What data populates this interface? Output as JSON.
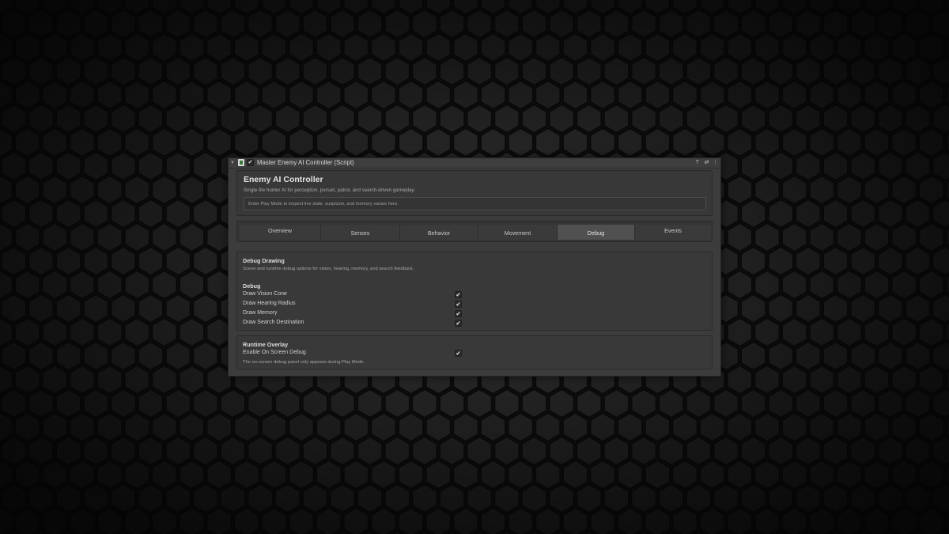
{
  "component": {
    "title": "Master Enemy AI Controller (Script)",
    "enabled": true,
    "icons": [
      "help-icon",
      "preset-icon",
      "more-icon"
    ]
  },
  "hero": {
    "title": "Enemy AI Controller",
    "subtitle": "Single-file hunter AI for perception, pursuit, patrol, and search-driven gameplay.",
    "status": "Enter Play Mode to inspect live state, suspicion, and memory values here."
  },
  "tabs": [
    {
      "label": "Overview",
      "active": false
    },
    {
      "label": "Senses",
      "active": false
    },
    {
      "label": "Behavior",
      "active": false
    },
    {
      "label": "Movement",
      "active": false
    },
    {
      "label": "Debug",
      "active": true
    },
    {
      "label": "Events",
      "active": false
    }
  ],
  "debug_drawing": {
    "title": "Debug Drawing",
    "description": "Scene and runtime debug options for vision, hearing, memory, and search feedback.",
    "group_label": "Debug",
    "fields": [
      {
        "label": "Draw Vision Cone",
        "checked": true
      },
      {
        "label": "Draw Hearing Radius",
        "checked": true
      },
      {
        "label": "Draw Memory",
        "checked": true
      },
      {
        "label": "Draw Search Destination",
        "checked": true
      }
    ]
  },
  "runtime_overlay": {
    "title": "Runtime Overlay",
    "fields": [
      {
        "label": "Enable On Screen Debug",
        "checked": true
      }
    ],
    "note": "The on-screen debug panel only appears during Play Mode."
  },
  "colors": {
    "background": "#161616",
    "panel": "#3c3c3c",
    "active_tab": "#505050",
    "text": "#dadada"
  }
}
